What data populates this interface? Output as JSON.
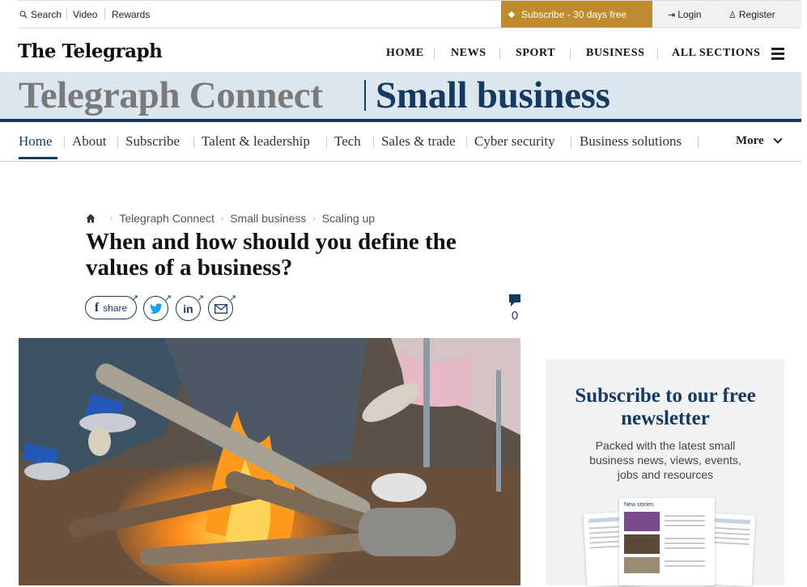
{
  "topbar": {
    "search": "Search",
    "video": "Video",
    "rewards": "Rewards",
    "subscribe": "Subscribe - 30 days free",
    "login": "Login",
    "register": "Register"
  },
  "masthead": {
    "logo": "The Telegraph",
    "nav": [
      "HOME",
      "NEWS",
      "SPORT",
      "BUSINESS",
      "ALL SECTIONS"
    ]
  },
  "banner": {
    "brand": "Telegraph Connect",
    "section": "Small business"
  },
  "section_nav": {
    "items": [
      "Home",
      "About",
      "Subscribe",
      "Talent & leadership",
      "Tech",
      "Sales & trade",
      "Cyber security",
      "Business solutions"
    ],
    "more": "More"
  },
  "breadcrumb": [
    "Telegraph Connect",
    "Small business",
    "Scaling up"
  ],
  "article": {
    "headline": "When and how should you define the values of a business?",
    "share_label": "share",
    "comment_count": "0"
  },
  "newsletter": {
    "title": "Subscribe to our free newsletter",
    "description": "Packed with the latest small business news, views, events, jobs and resources",
    "preview_header": "New stories"
  },
  "colors": {
    "navy": "#163a5f",
    "gold": "#c08a2e",
    "banner_bg": "#dce6ef"
  }
}
